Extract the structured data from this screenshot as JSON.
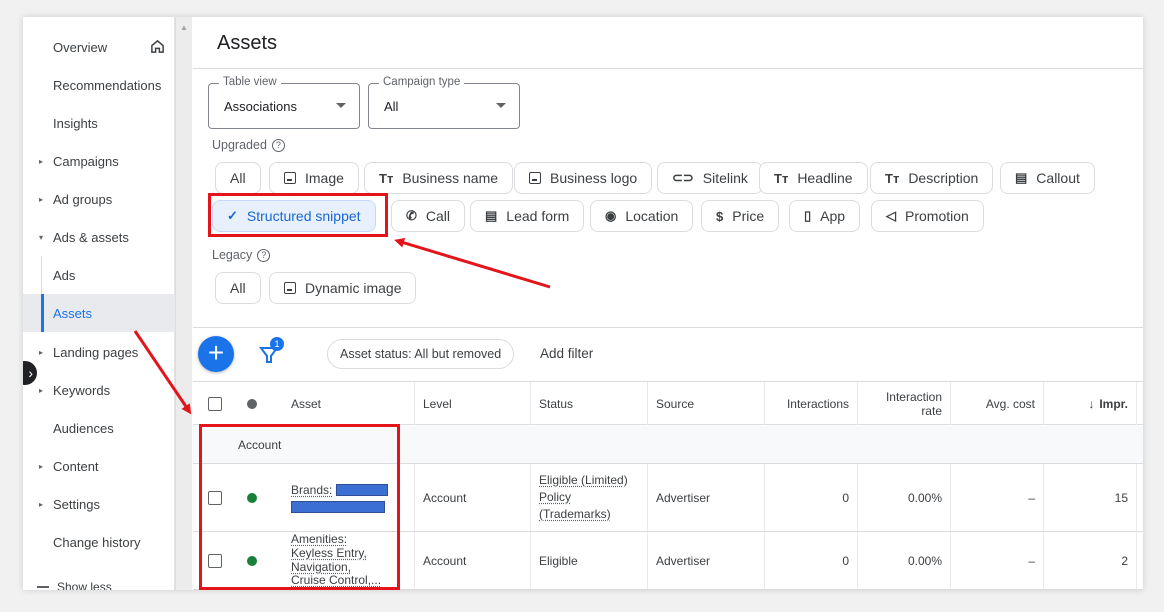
{
  "sidebar": {
    "items": [
      {
        "label": "Overview",
        "caret": ""
      },
      {
        "label": "Recommendations",
        "caret": ""
      },
      {
        "label": "Insights",
        "caret": ""
      },
      {
        "label": "Campaigns",
        "caret": "▸"
      },
      {
        "label": "Ad groups",
        "caret": "▸"
      },
      {
        "label": "Ads & assets",
        "caret": "▾"
      },
      {
        "label": "Ads",
        "caret": ""
      },
      {
        "label": "Assets",
        "caret": ""
      },
      {
        "label": "Landing pages",
        "caret": "▸"
      },
      {
        "label": "Keywords",
        "caret": "▸"
      },
      {
        "label": "Audiences",
        "caret": ""
      },
      {
        "label": "Content",
        "caret": "▸"
      },
      {
        "label": "Settings",
        "caret": "▸"
      },
      {
        "label": "Change history",
        "caret": ""
      }
    ],
    "show_less": "Show less",
    "active": "Assets"
  },
  "header": {
    "title": "Assets"
  },
  "table_view": {
    "label": "Table view",
    "value": "Associations"
  },
  "campaign_type": {
    "label": "Campaign type",
    "value": "All"
  },
  "upgraded": {
    "label": "Upgraded",
    "chips_row1": [
      {
        "label": "All",
        "icon": ""
      },
      {
        "label": "Image",
        "icon": "image-icon"
      },
      {
        "label": "Business name",
        "icon": "text-icon"
      },
      {
        "label": "Business logo",
        "icon": "image-icon"
      },
      {
        "label": "Sitelink",
        "icon": "link-icon"
      },
      {
        "label": "Headline",
        "icon": "text-icon"
      },
      {
        "label": "Description",
        "icon": "text-icon"
      },
      {
        "label": "Callout",
        "icon": "document-icon"
      }
    ],
    "chips_row2": [
      {
        "label": "Structured snippet",
        "icon": "check-icon",
        "selected": true
      },
      {
        "label": "Call",
        "icon": "phone-icon"
      },
      {
        "label": "Lead form",
        "icon": "form-icon"
      },
      {
        "label": "Location",
        "icon": "location-icon"
      },
      {
        "label": "Price",
        "icon": "price-icon"
      },
      {
        "label": "App",
        "icon": "phone-device-icon"
      },
      {
        "label": "Promotion",
        "icon": "megaphone-icon"
      }
    ]
  },
  "legacy": {
    "label": "Legacy",
    "chips": [
      {
        "label": "All",
        "icon": ""
      },
      {
        "label": "Dynamic image",
        "icon": "image-icon"
      }
    ]
  },
  "toolbar": {
    "filter_badge": "1",
    "status_filter": "Asset status: All but removed",
    "add_filter": "Add filter"
  },
  "table": {
    "columns": {
      "asset": "Asset",
      "level": "Level",
      "status": "Status",
      "source": "Source",
      "interactions": "Interactions",
      "interaction_rate": "Interaction rate",
      "avg_cost": "Avg. cost",
      "impr": "Impr."
    },
    "group_label": "Account",
    "rows": [
      {
        "asset": "Brands:",
        "level": "Account",
        "status": "Eligible (Limited) Policy (Trademarks)",
        "source": "Advertiser",
        "interactions": "0",
        "interaction_rate": "0.00%",
        "avg_cost": "–",
        "impr": "15",
        "status_color": "#188038"
      },
      {
        "asset": "Amenities: Keyless Entry, Navigation, Cruise Control,...",
        "level": "Account",
        "status": "Eligible",
        "source": "Advertiser",
        "interactions": "0",
        "interaction_rate": "0.00%",
        "avg_cost": "–",
        "impr": "2",
        "status_color": "#188038"
      }
    ]
  },
  "colors": {
    "accent": "#1a73e8",
    "highlight": "#e3151b",
    "eligible": "#188038"
  }
}
